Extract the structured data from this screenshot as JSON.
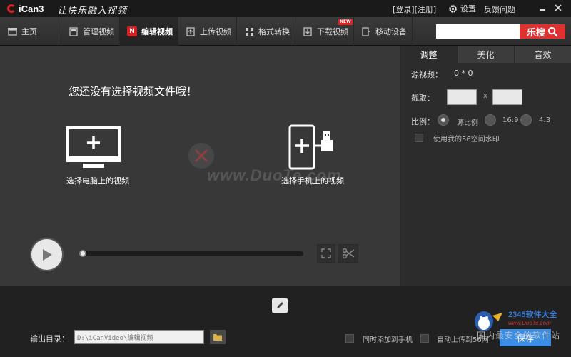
{
  "app": {
    "name": "iCan3",
    "slogan": "让快乐融入视频"
  },
  "titlebar": {
    "auth": "[登录][注册]",
    "settings": "设置",
    "feedback": "反馈问题",
    "minimize_icon": "minimize-icon",
    "close_icon": "close-icon"
  },
  "nav": {
    "items": [
      {
        "label": "主页",
        "icon": "home-icon"
      },
      {
        "label": "管理视频",
        "icon": "video-manage-icon"
      },
      {
        "label": "编辑视频",
        "icon": "edit-video-icon",
        "active": true
      },
      {
        "label": "上传视频",
        "icon": "upload-icon"
      },
      {
        "label": "格式转换",
        "icon": "convert-icon"
      },
      {
        "label": "下载视频",
        "icon": "download-icon",
        "badge": "NEW"
      },
      {
        "label": "移动设备",
        "icon": "mobile-device-icon"
      }
    ],
    "search_placeholder": "",
    "search_button": "乐搜"
  },
  "preview": {
    "empty_message": "您还没有选择视频文件哦！",
    "pc_label": "选择电脑上的视频",
    "phone_label": "选择手机上的视频",
    "watermark": "www.DuoTe.com",
    "progress": 0
  },
  "right_panel": {
    "tabs": [
      "调整",
      "美化",
      "音效"
    ],
    "active_tab": 0,
    "source_label": "源视频：",
    "source_value": "0 * 0",
    "crop_label": "截取：",
    "crop_separator": "x",
    "crop_width": "",
    "crop_height": "",
    "ratio_label": "比例：",
    "ratio_options": [
      "源比例",
      "16:9",
      "4:3"
    ],
    "ratio_selected": 0,
    "watermark_label": "使用我的56空间水印",
    "watermark_checked": false
  },
  "bottom": {
    "output_label": "输出目录：",
    "output_path": "D:\\iCanVideo\\编辑视频",
    "option1": "同时添加到手机",
    "option2": "自动上传到56网",
    "save_button": "保存"
  },
  "corner_watermark": {
    "brand": "2345软件大全",
    "url": "www.DuoTe.com",
    "slogan": "国内最安全的软件站"
  },
  "colors": {
    "accent_red": "#e03030",
    "save_blue": "#3a8ee6",
    "panel_bg": "#383838"
  }
}
